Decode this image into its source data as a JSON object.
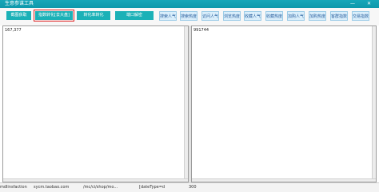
{
  "window": {
    "title": "生意参谋工具",
    "controls": [
      "—",
      "✕"
    ]
  },
  "toolbar": {
    "buttons": [
      "截图获取",
      "指数转化[去大盘]",
      "转化率转化",
      "端口解密"
    ],
    "selected_index": 1,
    "metrics": [
      "搜索人气",
      "搜索热度",
      "访问人气",
      "浏览热度",
      "收藏人气",
      "收藏热度",
      "加购人气",
      "加购热度",
      "客群指数",
      "交易指数"
    ]
  },
  "panels": {
    "left_value": "167,377",
    "right_value": "991744"
  },
  "bottom": {
    "items": [
      "mdlinsfaction",
      "sycm.taobao.com",
      "/mc/ci/shop/mo...",
      "[dateType=d",
      "300"
    ]
  },
  "colors": {
    "title_bar": "#12a0b2",
    "button_teal": "#1bb1b7",
    "chip_blue": "#d9eefb",
    "selected_outline": "#e02020"
  }
}
